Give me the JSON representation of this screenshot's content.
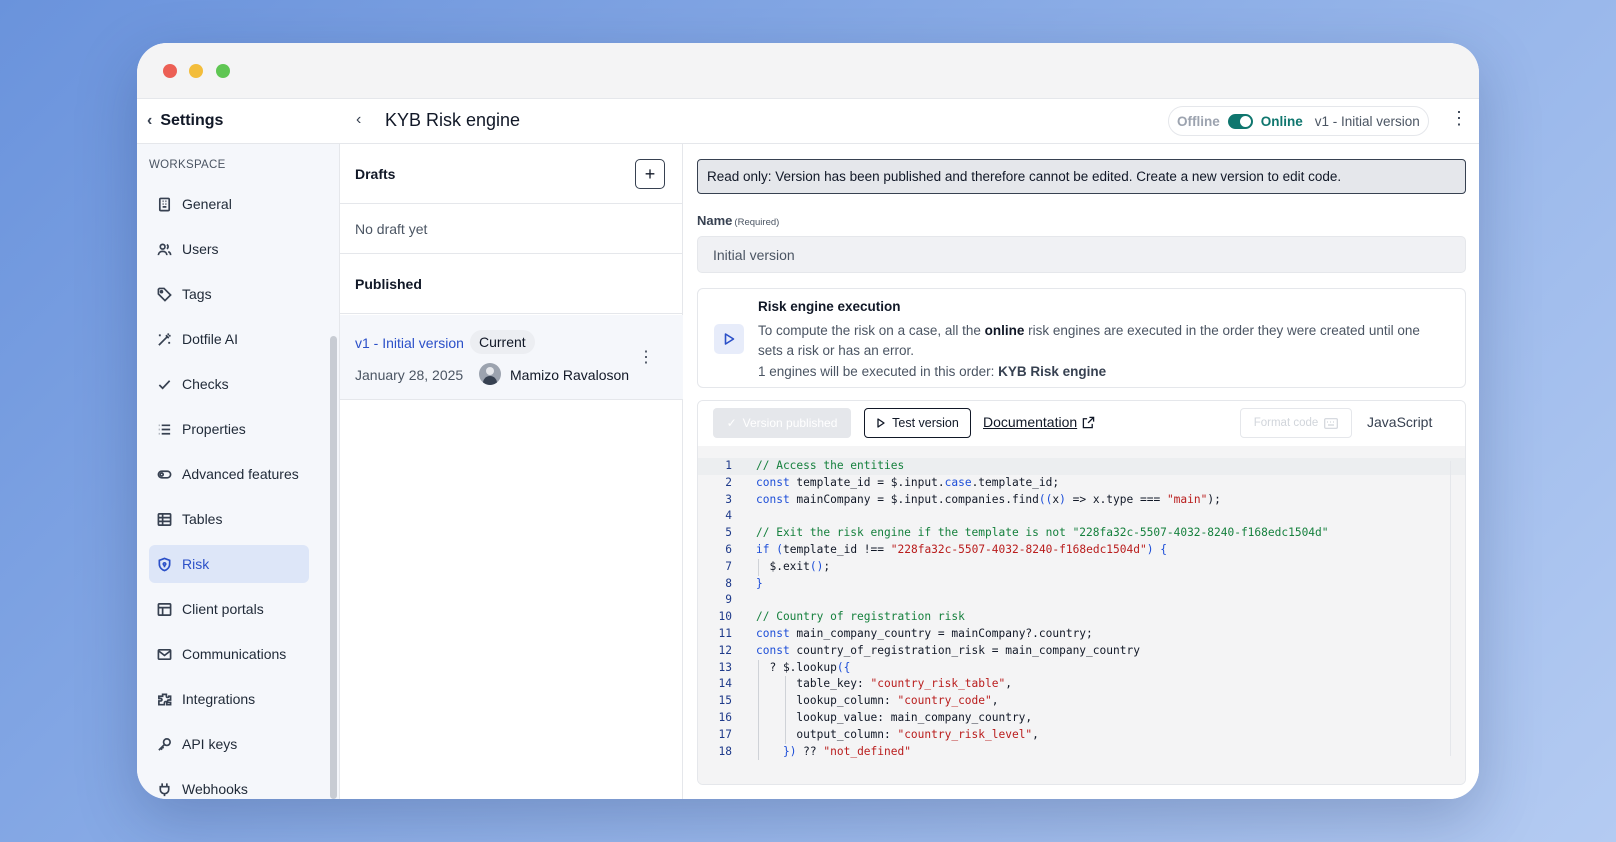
{
  "sidebar": {
    "back_label": "Settings",
    "section": "WORKSPACE",
    "items": [
      {
        "label": "General",
        "icon": "building-icon"
      },
      {
        "label": "Users",
        "icon": "users-icon"
      },
      {
        "label": "Tags",
        "icon": "tag-icon"
      },
      {
        "label": "Dotfile AI",
        "icon": "magic-wand-icon"
      },
      {
        "label": "Checks",
        "icon": "check-icon"
      },
      {
        "label": "Properties",
        "icon": "list-icon"
      },
      {
        "label": "Advanced features",
        "icon": "toggle-icon"
      },
      {
        "label": "Tables",
        "icon": "table-icon"
      },
      {
        "label": "Risk",
        "icon": "shield-icon",
        "active": true
      },
      {
        "label": "Client portals",
        "icon": "layout-icon"
      },
      {
        "label": "Communications",
        "icon": "mail-icon"
      },
      {
        "label": "Integrations",
        "icon": "puzzle-icon"
      },
      {
        "label": "API keys",
        "icon": "key-icon"
      },
      {
        "label": "Webhooks",
        "icon": "plug-icon"
      }
    ]
  },
  "header": {
    "title": "KYB Risk engine",
    "offline_label": "Offline",
    "online_label": "Online",
    "version_label": "v1 - Initial version",
    "accent": "#0f766e"
  },
  "versions": {
    "drafts_label": "Drafts",
    "no_draft": "No draft yet",
    "published_label": "Published",
    "item": {
      "name": "v1 - Initial version",
      "badge": "Current",
      "date": "January 28, 2025",
      "author": "Mamizo Ravaloson"
    }
  },
  "editor_panel": {
    "readonly_notice": "Read only: Version has been published and therefore cannot be edited. Create a new version to edit code.",
    "name_label": "Name",
    "name_required": "(Required)",
    "name_value": "Initial version",
    "exec_title": "Risk engine execution",
    "exec_desc_1": "To compute the risk on a case, all the ",
    "exec_desc_bold": "online",
    "exec_desc_2": " risk engines are executed in the order they were created until one sets a risk or has an error.",
    "exec_order_prefix": "1 engines will be executed in this order: ",
    "exec_order_engine": "KYB Risk engine",
    "btn_published": "Version published",
    "btn_test": "Test version",
    "doc_link": "Documentation",
    "btn_format": "Format code",
    "language": "JavaScript",
    "line_numbers": [
      "1",
      "2",
      "3",
      "4",
      "5",
      "6",
      "7",
      "8",
      "9",
      "10",
      "11",
      "12",
      "13",
      "14",
      "15",
      "16",
      "17",
      "18"
    ]
  }
}
